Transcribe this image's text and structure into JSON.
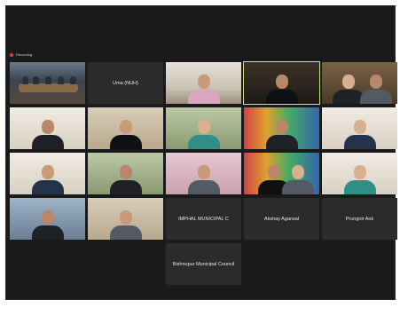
{
  "recording": {
    "label": "Recording"
  },
  "participants": [
    {
      "label": ""
    },
    {
      "label": "Uma (NUH)"
    },
    {
      "label": ""
    },
    {
      "label": ""
    },
    {
      "label": ""
    },
    {
      "label": ""
    },
    {
      "label": ""
    },
    {
      "label": ""
    },
    {
      "label": ""
    },
    {
      "label": ""
    },
    {
      "label": ""
    },
    {
      "label": ""
    },
    {
      "label": ""
    },
    {
      "label": ""
    },
    {
      "label": ""
    },
    {
      "label": ""
    },
    {
      "label": ""
    },
    {
      "label": "IMPHAL MUNICIPAL C"
    },
    {
      "label": "Akshay Agarwal"
    },
    {
      "label": "Prungnir Aok"
    },
    {
      "label": "Bishnupur Municipal Council"
    }
  ]
}
